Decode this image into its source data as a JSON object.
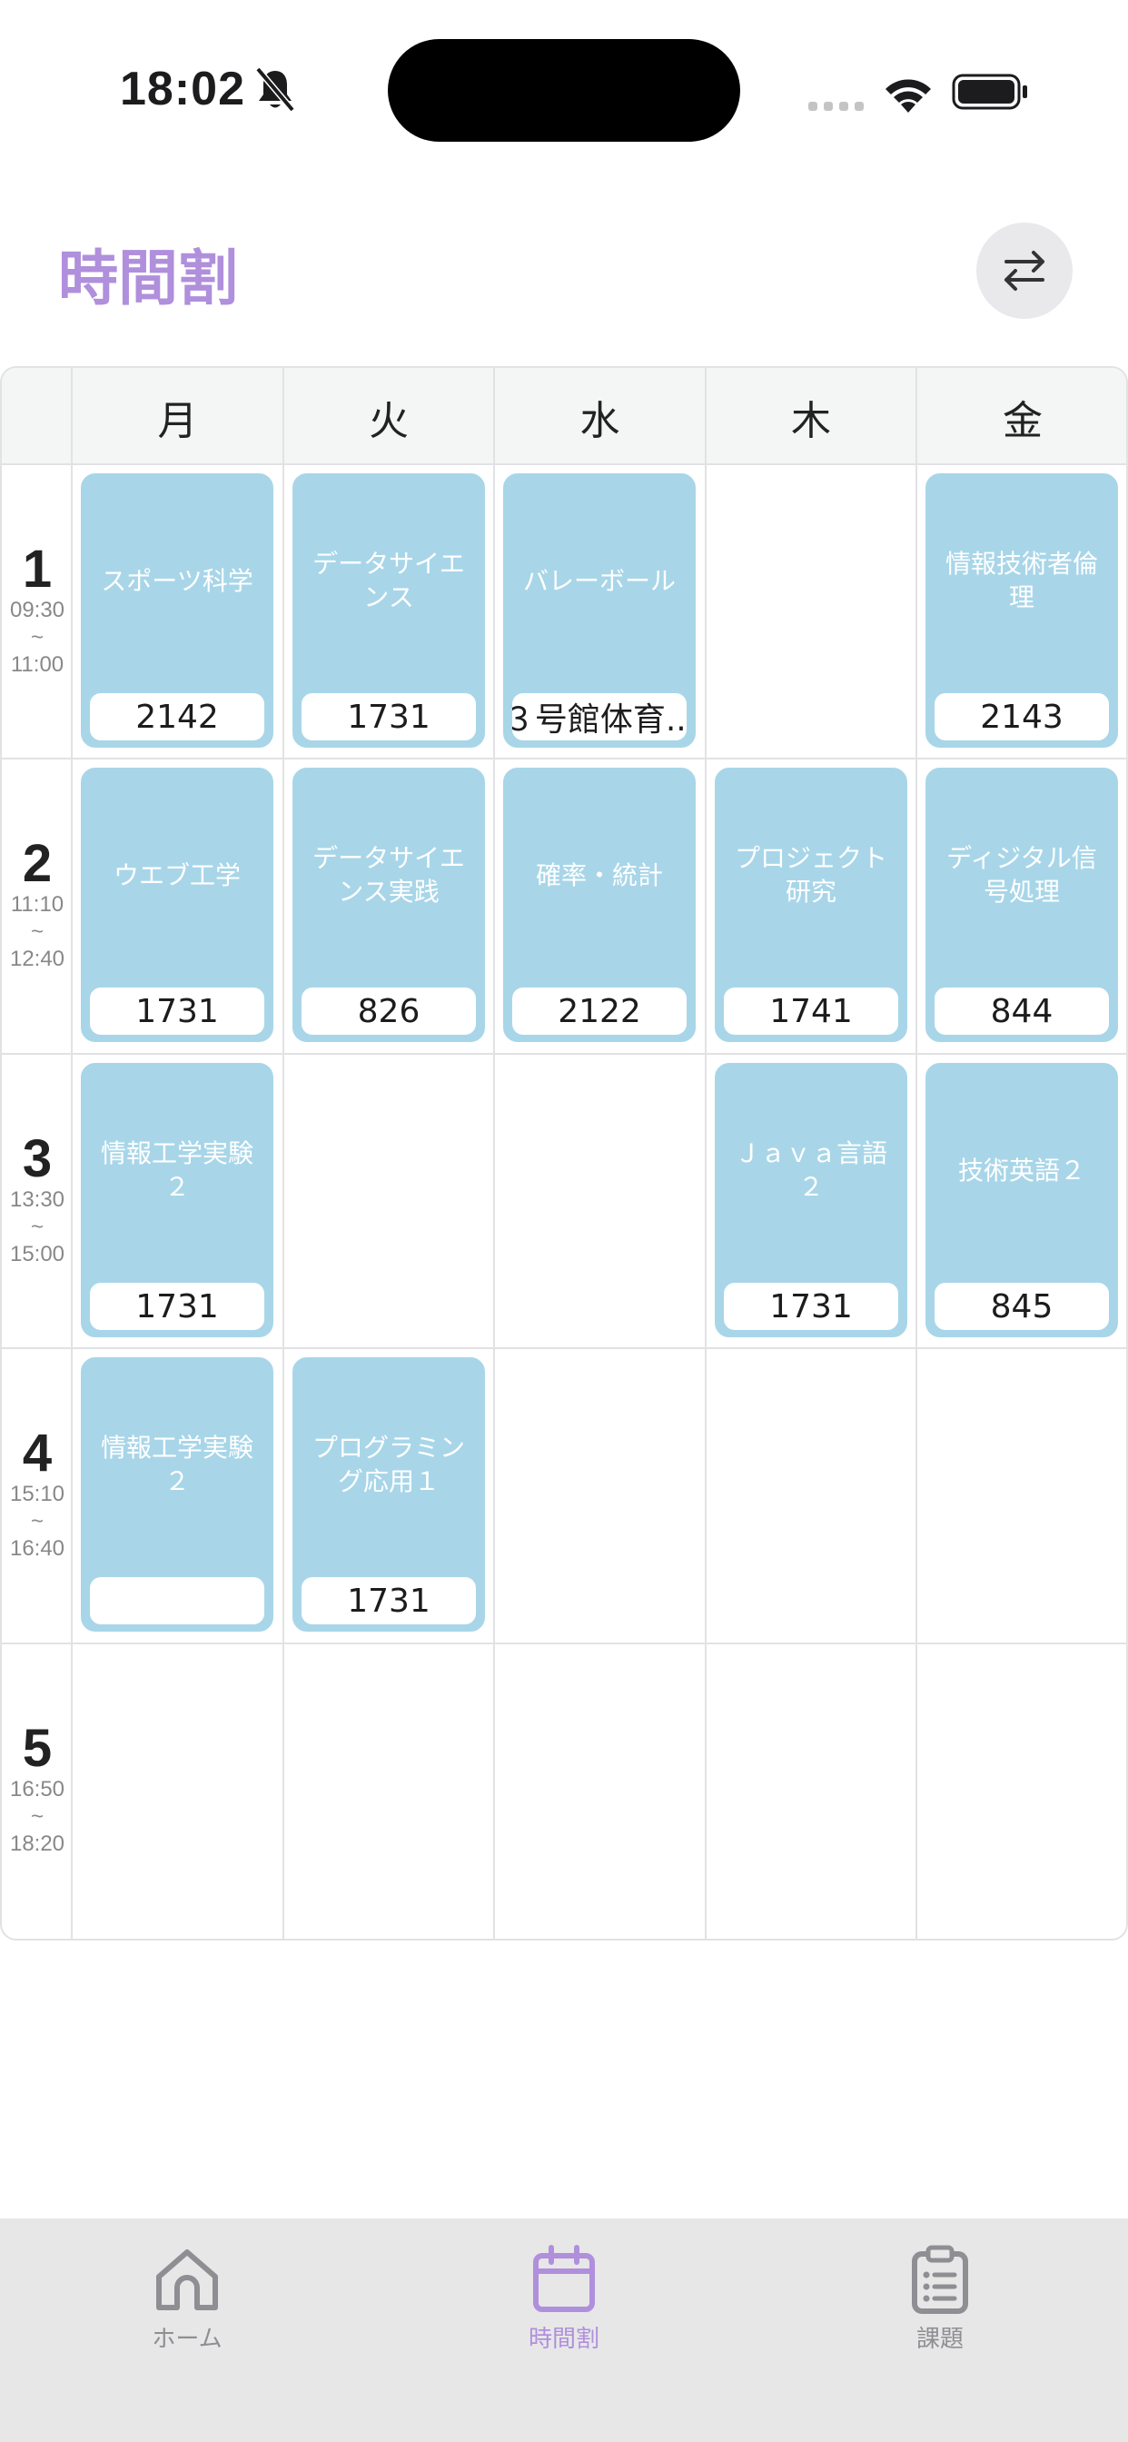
{
  "status_bar": {
    "time": "18:02"
  },
  "header": {
    "title": "時間割"
  },
  "days": [
    "月",
    "火",
    "水",
    "木",
    "金"
  ],
  "periods": [
    {
      "number": "1",
      "start": "09:30",
      "sep": "~",
      "end": "11:00"
    },
    {
      "number": "2",
      "start": "11:10",
      "sep": "~",
      "end": "12:40"
    },
    {
      "number": "3",
      "start": "13:30",
      "sep": "~",
      "end": "15:00"
    },
    {
      "number": "4",
      "start": "15:10",
      "sep": "~",
      "end": "16:40"
    },
    {
      "number": "5",
      "start": "16:50",
      "sep": "~",
      "end": "18:20"
    }
  ],
  "courses": {
    "p1_mon": {
      "name": "スポーツ科学",
      "room": "2142"
    },
    "p1_tue": {
      "name": "データサイエンス",
      "room": "1731"
    },
    "p1_wed": {
      "name": "バレーボール",
      "room": "３号館体育..."
    },
    "p1_fri": {
      "name": "情報技術者倫理",
      "room": "2143"
    },
    "p2_mon": {
      "name": "ウエブ工学",
      "room": "1731"
    },
    "p2_tue": {
      "name": "データサイエンス実践",
      "room": "826"
    },
    "p2_wed": {
      "name": "確率・統計",
      "room": "2122"
    },
    "p2_thu": {
      "name": "プロジェクト研究",
      "room": "1741"
    },
    "p2_fri": {
      "name": "ディジタル信号処理",
      "room": "844"
    },
    "p3_mon": {
      "name": "情報工学実験２",
      "room": "1731"
    },
    "p3_thu": {
      "name": "Ｊａｖａ言語２",
      "room": "1731"
    },
    "p3_fri": {
      "name": "技術英語２",
      "room": "845"
    },
    "p4_mon": {
      "name": "情報工学実験２",
      "room": ""
    },
    "p4_tue": {
      "name": "プログラミング応用１",
      "room": "1731"
    }
  },
  "tab_bar": {
    "items": [
      {
        "label": "ホーム",
        "icon": "home-icon",
        "active": false
      },
      {
        "label": "時間割",
        "icon": "calendar-icon",
        "active": true
      },
      {
        "label": "課題",
        "icon": "clipboard-icon",
        "active": false
      }
    ]
  },
  "colors": {
    "accent": "#b08fdc",
    "card": "#a8d6e8",
    "tab_inactive": "#8e8e93"
  }
}
